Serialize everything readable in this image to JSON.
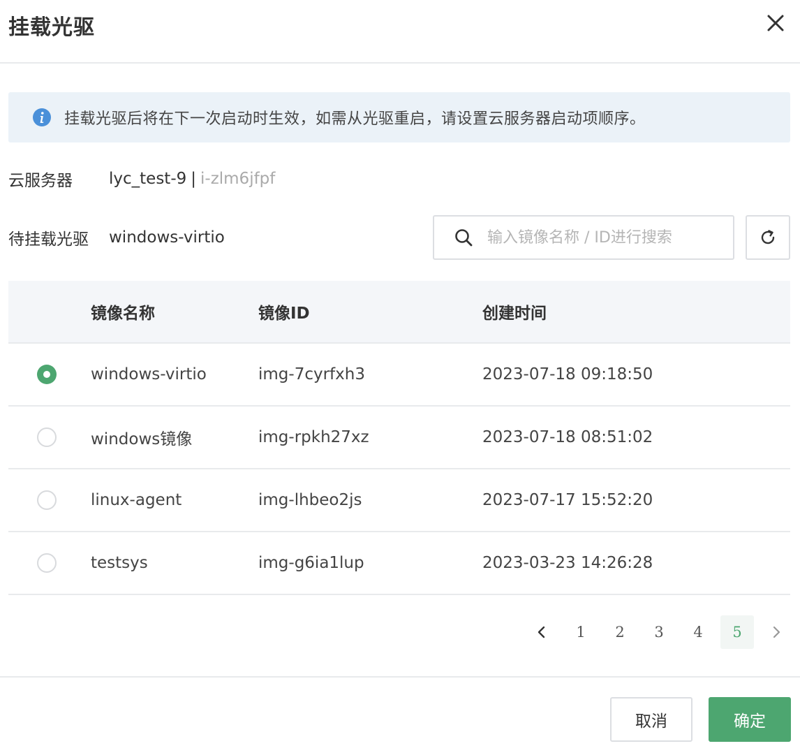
{
  "dialog": {
    "title": "挂载光驱",
    "close_icon": "close-icon"
  },
  "notice": {
    "icon": "info-icon",
    "text": "挂载光驱后将在下一次启动时生效，如需从光驱重启，请设置云服务器启动项顺序。",
    "background": "#ebf2f8",
    "icon_color": "#4a90d9"
  },
  "server": {
    "label": "云服务器",
    "name": "lyc_test-9",
    "separator": "|",
    "id": "i-zlm6jfpf"
  },
  "iso": {
    "label": "待挂载光驱",
    "value": "windows-virtio"
  },
  "search": {
    "icon": "search-icon",
    "placeholder": "输入镜像名称 / ID进行搜索",
    "value": ""
  },
  "refresh": {
    "icon": "refresh-icon"
  },
  "table": {
    "columns": [
      "",
      "镜像名称",
      "镜像ID",
      "创建时间"
    ],
    "rows": [
      {
        "selected": true,
        "name": "windows-virtio",
        "id": "img-7cyrfxh3",
        "created": "2023-07-18 09:18:50"
      },
      {
        "selected": false,
        "name": "windows镜像",
        "id": "img-rpkh27xz",
        "created": "2023-07-18 08:51:02"
      },
      {
        "selected": false,
        "name": "linux-agent",
        "id": "img-lhbeo2js",
        "created": "2023-07-17 15:52:20"
      },
      {
        "selected": false,
        "name": "testsys",
        "id": "img-g6ia1lup",
        "created": "2023-03-23 14:26:28"
      }
    ]
  },
  "pagination": {
    "prev_icon": "chevron-left-icon",
    "next_icon": "chevron-right-icon",
    "pages": [
      "1",
      "2",
      "3",
      "4",
      "5"
    ],
    "current": "5"
  },
  "footer": {
    "cancel_label": "取消",
    "ok_label": "确定"
  },
  "colors": {
    "accent": "#4da670",
    "border": "#dcdee2",
    "muted_text": "#aaaaaa"
  }
}
